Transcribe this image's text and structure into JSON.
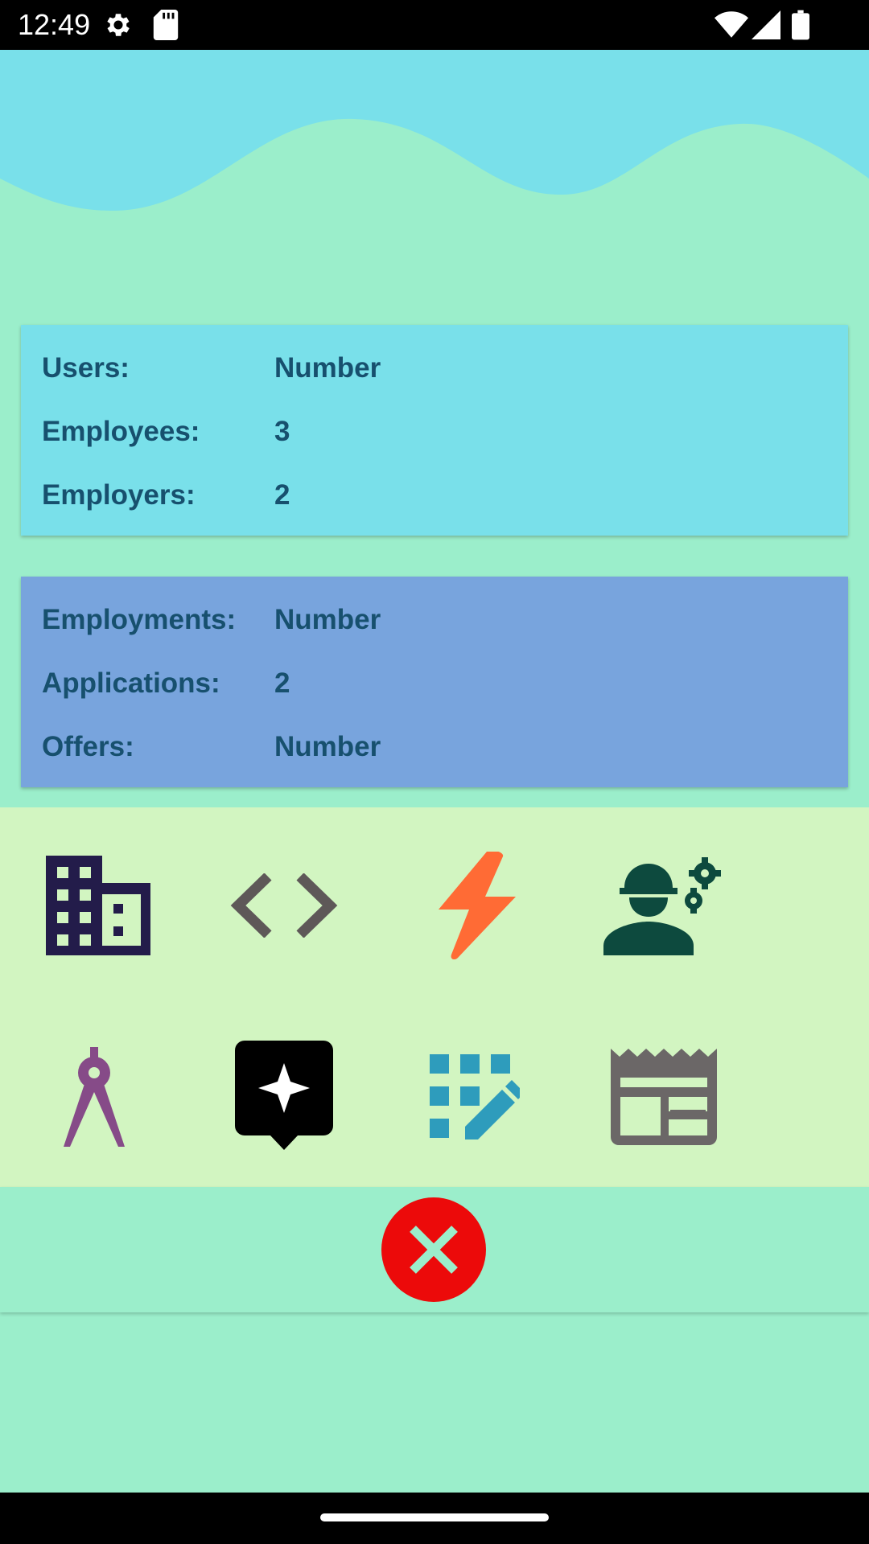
{
  "status_bar": {
    "time": "12:49",
    "icons": [
      "settings-icon",
      "sd-card-icon",
      "wifi-icon",
      "signal-icon",
      "battery-icon"
    ]
  },
  "stats_users": {
    "rows": [
      {
        "label": "Users:",
        "value": "Number"
      },
      {
        "label": "Employees:",
        "value": "3"
      },
      {
        "label": "Employers:",
        "value": "2"
      }
    ]
  },
  "stats_jobs": {
    "rows": [
      {
        "label": "Employments:",
        "value": "Number"
      },
      {
        "label": "Applications:",
        "value": "2"
      },
      {
        "label": "Offers:",
        "value": "Number"
      }
    ]
  },
  "icon_grid": [
    {
      "icon": "building-icon",
      "color": "#231c4a"
    },
    {
      "icon": "code-icon",
      "color": "#5e5858"
    },
    {
      "icon": "bolt-icon",
      "color": "#ff6b35"
    },
    {
      "icon": "engineer-icon",
      "color": "#0d4a3e"
    },
    {
      "icon": "compass-icon",
      "color": "#864b88"
    },
    {
      "icon": "sparkle-bubble-icon",
      "color": "#000000"
    },
    {
      "icon": "grid-edit-icon",
      "color": "#2e9cbc"
    },
    {
      "icon": "newspaper-icon",
      "color": "#6b6767"
    }
  ],
  "close_button": {
    "icon": "close-icon",
    "color": "#ec0a0a"
  },
  "colors": {
    "background": "#9beecb",
    "wave": "#79e0ea",
    "card_users": "#79e0ea",
    "card_jobs": "#78a4dd",
    "icon_panel": "#d2f5c1",
    "text": "#17506e"
  }
}
